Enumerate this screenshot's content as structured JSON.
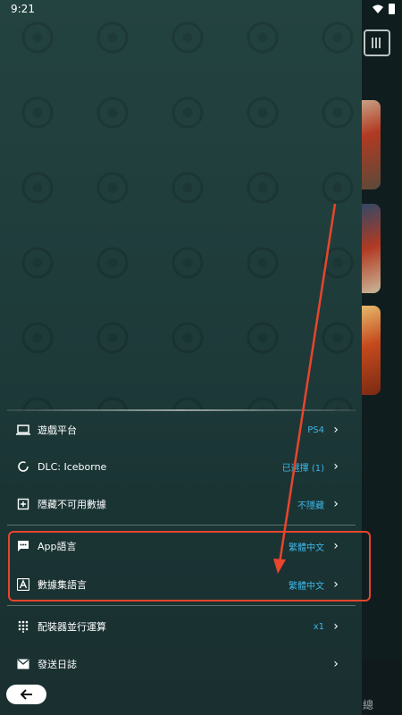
{
  "status_bar": {
    "time": "9:21"
  },
  "background_app": {
    "footer_text": "總"
  },
  "menu": {
    "items": [
      {
        "label": "遊戲平台",
        "value": "PS4",
        "icon": "laptop-icon"
      },
      {
        "label": "DLC: Iceborne",
        "value": "已選擇 (1)",
        "icon": "dlc-ring-icon"
      },
      {
        "label": "隱藏不可用數據",
        "value": "不隱藏",
        "icon": "hide-data-icon"
      },
      {
        "label": "App語言",
        "value": "繁體中文",
        "icon": "chat-bubble-icon"
      },
      {
        "label": "數據集語言",
        "value": "繁體中文",
        "icon": "font-a-icon"
      },
      {
        "label": "配裝器並行運算",
        "value": "x1",
        "icon": "grid-dots-icon"
      },
      {
        "label": "發送日誌",
        "value": "",
        "icon": "mail-icon"
      }
    ]
  },
  "back_button": {
    "icon": "arrow-left-icon"
  },
  "annotation": {
    "color": "#e8452c"
  },
  "colors": {
    "accent_value": "#3db7e8",
    "drawer_bg": "#1e3b3a"
  }
}
